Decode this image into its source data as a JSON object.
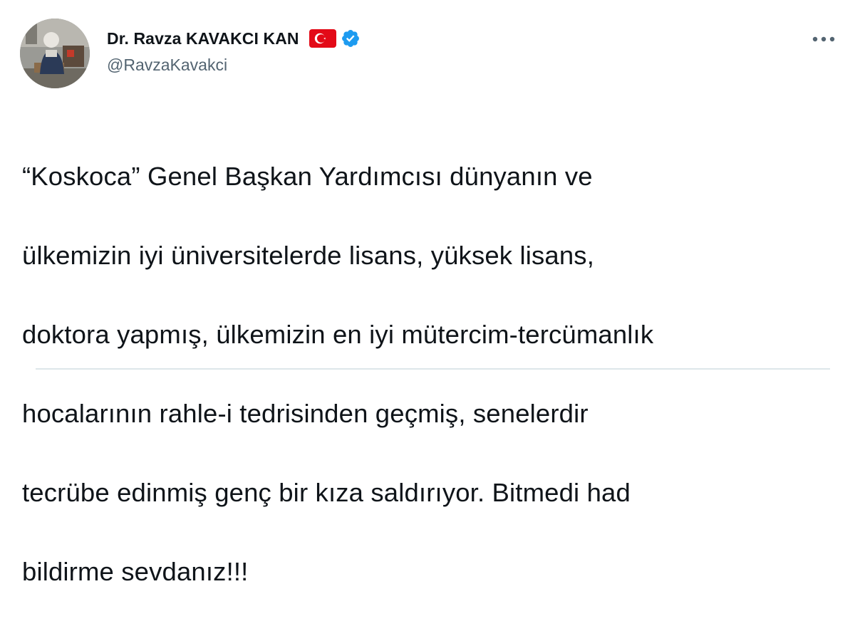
{
  "tweet": {
    "author": {
      "display_name": "Dr. Ravza KAVAKCI KAN",
      "handle": "@RavzaKavakci",
      "verified": true,
      "flag_icon": "turkey-flag-icon"
    },
    "text_lines": [
      "“Koskoca” Genel Başkan Yardımcısı dünyanın ve",
      "ülkemizin iyi üniversitelerde lisans, yüksek lisans,",
      "doktora yapmış, ülkemizin en iyi mütercim-tercümanlık",
      "hocalarının rahle-i tedrisinden geçmiş, senelerdir",
      "tecrübe edinmiş genç bir kıza saldırıyor. Bitmedi had",
      "bildirme sevdanız!!!"
    ]
  },
  "colors": {
    "text": "#0f1419",
    "secondary": "#536471",
    "verified_blue": "#1d9bf0",
    "flag_red": "#e30a17"
  },
  "icons": {
    "more": "more-options-icon",
    "verified": "verified-badge-icon",
    "flag": "turkey-flag-icon"
  }
}
